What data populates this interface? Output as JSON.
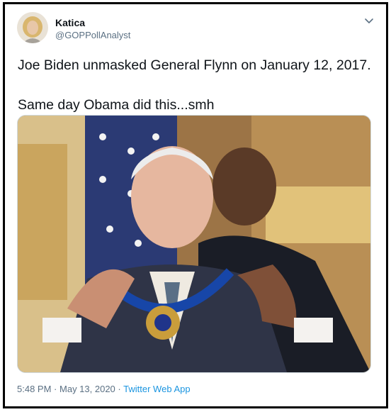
{
  "tweet": {
    "author": {
      "name": "Katica",
      "handle": "@GOPPollAnalyst"
    },
    "text_lines": [
      "Joe Biden unmasked General Flynn on January 12, 2017.",
      "Same day Obama did this...smh"
    ],
    "meta": {
      "time": "5:48 PM",
      "separator": "·",
      "date": "May 13, 2020",
      "app": "Twitter Web App"
    },
    "icons": {
      "avatar": "avatar",
      "menu": "chevron-down-icon"
    }
  }
}
